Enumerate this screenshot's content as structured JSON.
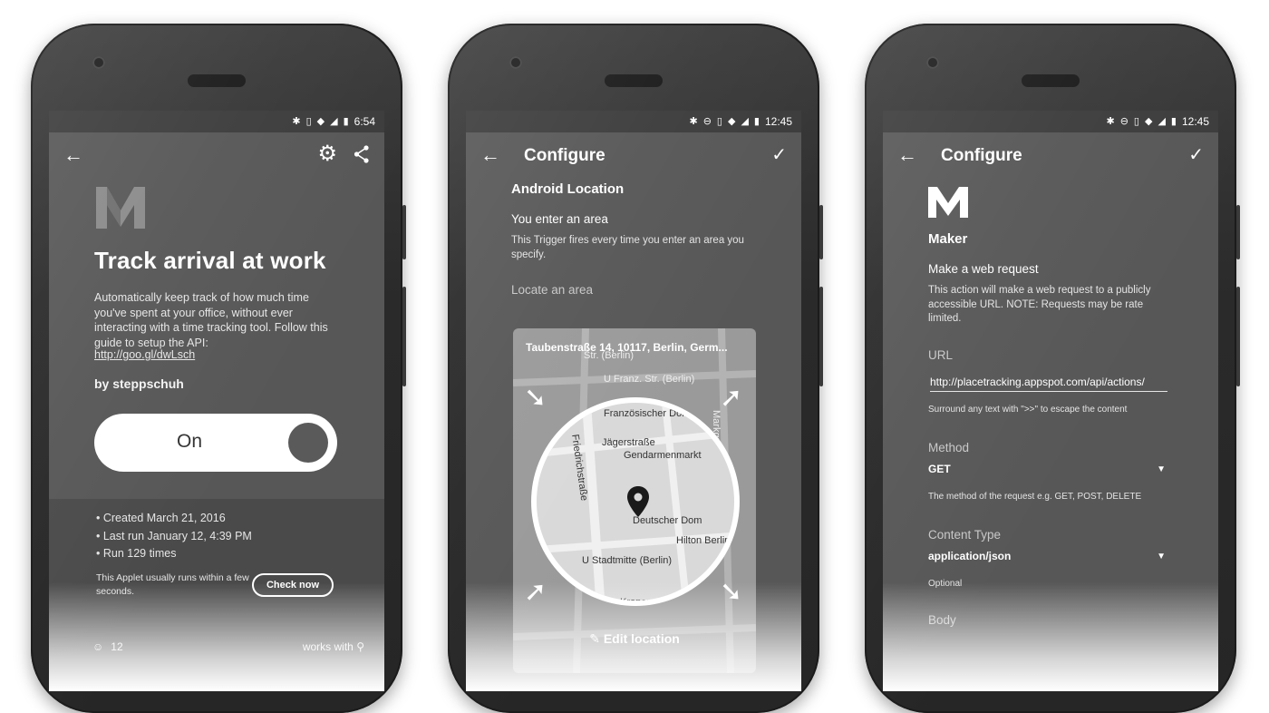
{
  "phone1": {
    "status": {
      "time": "6:54"
    },
    "appbar": {
      "back_icon": "arrow-left-icon",
      "settings_icon": "gear-icon",
      "share_icon": "share-icon"
    },
    "logo": "M",
    "title": "Track arrival at work",
    "description": "Automatically keep track of how much time you've spent at your office, without ever interacting with a time tracking tool. Follow this guide to setup the API:",
    "link": "http://goo.gl/dwLsch",
    "author": "by steppschuh",
    "toggle_label": "On",
    "meta": [
      "• Created March 21, 2016",
      "• Last run January 12, 4:39 PM",
      "• Run 129 times"
    ],
    "hint": "This Applet usually runs within a few seconds.",
    "check_now": "Check now",
    "user_count": "12",
    "works_with": "works with"
  },
  "phone2": {
    "status": {
      "time": "12:45"
    },
    "appbar": {
      "title": "Configure"
    },
    "service": "Android Location",
    "trigger": "You enter an area",
    "trigger_desc": "This Trigger fires every time you enter an area you specify.",
    "locate_label": "Locate an area",
    "map": {
      "address": "Taubenstraße 14, 10117, Berlin, Germ...",
      "labels": [
        "Französischer Dom",
        "Jägerstraße",
        "Gendarmenmarkt",
        "Friedrichstraße",
        "Deutscher Dom",
        "Hilton Berlin",
        "U Stadtmitte (Berlin)",
        "Kronenstraße",
        "U Franz. Str. (Berlin)",
        "Str. (Berlin)",
        "Markgrafenstraße"
      ],
      "edit_label": "Edit location"
    }
  },
  "phone3": {
    "status": {
      "time": "12:45"
    },
    "appbar": {
      "title": "Configure"
    },
    "logo": "M",
    "service": "Maker",
    "action": "Make a web request",
    "action_desc": "This action will make a web request to a publicly accessible URL. NOTE: Requests may be rate limited.",
    "url_label": "URL",
    "url_value": "http://placetracking.appspot.com/api/actions/",
    "url_hint": "Surround any text with \">>\" to escape the content",
    "method_label": "Method",
    "method_value": "GET",
    "method_hint": "The method of the request e.g. GET, POST, DELETE",
    "content_type_label": "Content Type",
    "content_type_value": "application/json",
    "content_type_hint": "Optional",
    "body_label": "Body"
  }
}
